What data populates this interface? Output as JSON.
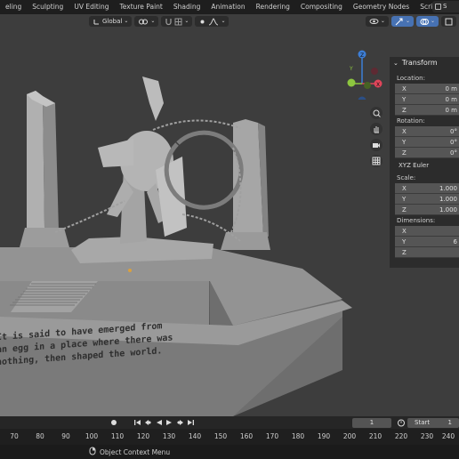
{
  "workspace_tabs": [
    "eling",
    "Sculpting",
    "UV Editing",
    "Texture Paint",
    "Shading",
    "Animation",
    "Rendering",
    "Compositing",
    "Geometry Nodes",
    "Scripting"
  ],
  "add_tab": "+",
  "scene_chip": "S",
  "viewport_header": {
    "orientation": "Global"
  },
  "sidebar": {
    "panel_title": "Transform",
    "location_label": "Location:",
    "location": [
      {
        "axis": "X",
        "value": "0 m"
      },
      {
        "axis": "Y",
        "value": "0 m"
      },
      {
        "axis": "Z",
        "value": "0 m"
      }
    ],
    "rotation_label": "Rotation:",
    "rotation": [
      {
        "axis": "X",
        "value": "0°"
      },
      {
        "axis": "Y",
        "value": "0°"
      },
      {
        "axis": "Z",
        "value": "0°"
      }
    ],
    "rotation_mode": "XYZ Euler",
    "scale_label": "Scale:",
    "scale": [
      {
        "axis": "X",
        "value": "1.000"
      },
      {
        "axis": "Y",
        "value": "1.000"
      },
      {
        "axis": "Z",
        "value": "1.000"
      }
    ],
    "dimensions_label": "Dimensions:",
    "dimensions": [
      {
        "axis": "X",
        "value": ""
      },
      {
        "axis": "Y",
        "value": "6"
      },
      {
        "axis": "Z",
        "value": ""
      }
    ]
  },
  "gizmo": {
    "y_label": "Y",
    "z_label": "Z",
    "x_label": "X"
  },
  "plaque_text": [
    "It is said to have emerged from",
    "an egg in a place where there was",
    "nothing, then shaped the world."
  ],
  "timeline": {
    "current_frame": "1",
    "start_label": "Start",
    "start_value": "1"
  },
  "ruler_ticks": [
    "70",
    "80",
    "90",
    "100",
    "110",
    "120",
    "130",
    "140",
    "150",
    "160",
    "170",
    "180",
    "190",
    "200",
    "210",
    "220",
    "230",
    "240"
  ],
  "status": {
    "context_menu": "Object Context Menu"
  },
  "colors": {
    "axis_x": "#e0455a",
    "axis_y": "#8dc63f",
    "axis_z": "#3d7ed6",
    "active_blue": "#4772b3"
  }
}
